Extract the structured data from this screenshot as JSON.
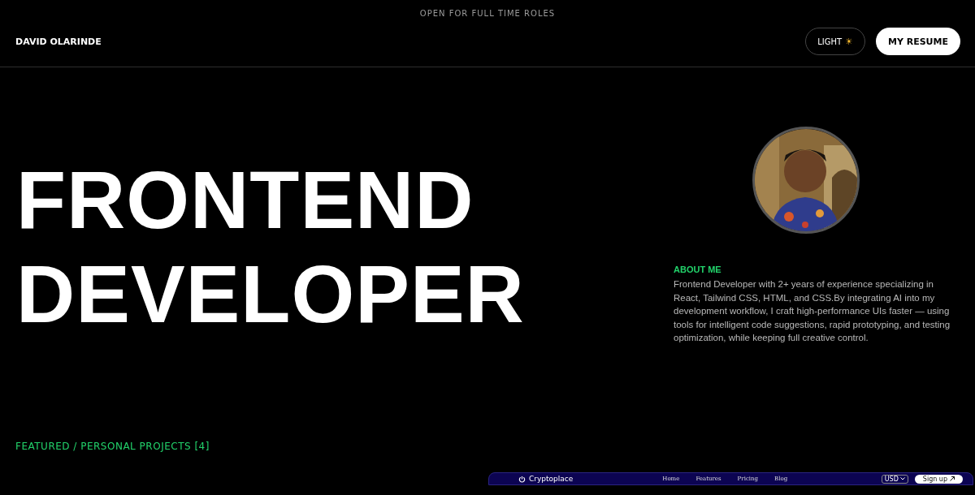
{
  "banner": "OPEN FOR FULL TIME ROLES",
  "header": {
    "name": "DAVID OLARINDE",
    "theme_button": {
      "label": "LIGHT",
      "icon": "☀"
    },
    "resume_button": "MY RESUME"
  },
  "hero": {
    "title_lines": [
      "FRONTEND",
      "DEVELOPER"
    ]
  },
  "about": {
    "heading": "ABOUT ME",
    "text": "Frontend Developer with 2+ years of experience specializing in React, Tailwind CSS, HTML, and CSS.By integrating AI into my development workflow, I craft high-performance UIs faster — using tools for intelligent code suggestions, rapid prototyping, and testing optimization, while keeping full creative control."
  },
  "projects": {
    "heading": "FEATURED / PERSONAL PROJECTS [4]",
    "preview": {
      "logo": "Cryptoplace",
      "nav": [
        "Home",
        "Features",
        "Pricing",
        "Blog"
      ],
      "currency": "USD",
      "signup": "Sign up"
    }
  }
}
